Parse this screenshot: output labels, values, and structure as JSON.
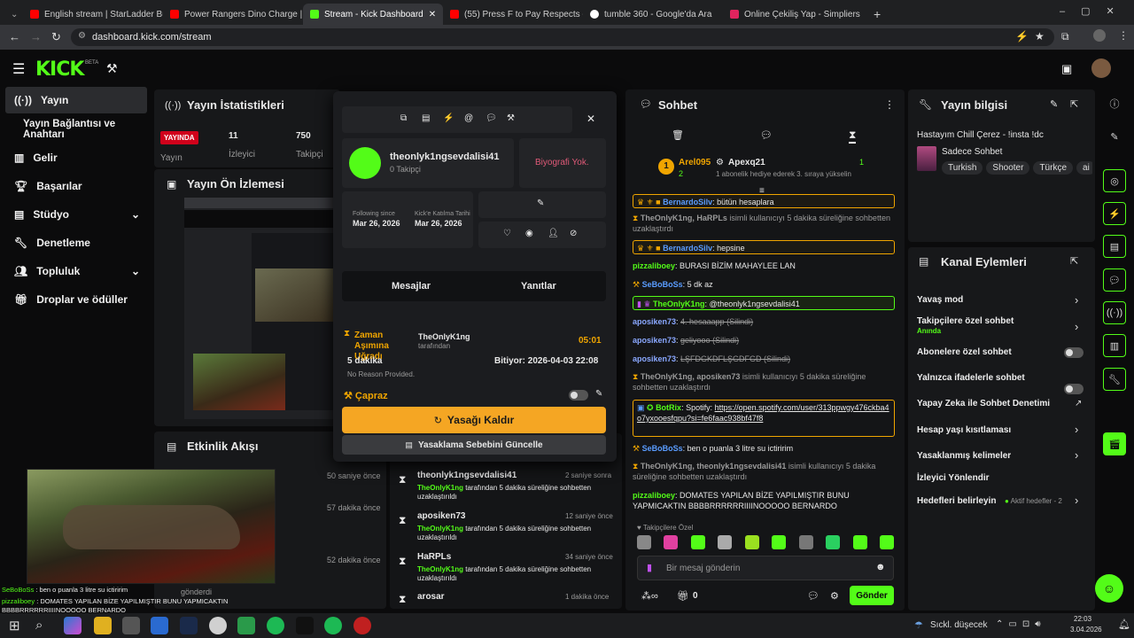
{
  "browser": {
    "tabs": [
      {
        "title": "English stream | StarLadder Bud",
        "color": "#ff0000"
      },
      {
        "title": "Power Rangers Dino Charge | S",
        "color": "#ff0000"
      },
      {
        "title": "Stream - Kick Dashboard",
        "color": "#53fc18"
      },
      {
        "title": "(55) Press F to Pay Respects - Y",
        "color": "#ff0000"
      },
      {
        "title": "tumble 360 - Google'da Ara",
        "color": "#ffffff"
      },
      {
        "title": "Online Çekiliş Yap - Simpliers",
        "color": "#e0245e"
      }
    ],
    "url": "dashboard.kick.com/stream"
  },
  "header": {
    "logo": "KICK",
    "beta": "BETA"
  },
  "sidebar": {
    "items": [
      {
        "label": "Yayın",
        "icon": "broadcast-icon"
      },
      {
        "label": "Yayın Bağlantısı ve Anahtarı"
      },
      {
        "label": "Gelir",
        "icon": "chart-icon"
      },
      {
        "label": "Başarılar",
        "icon": "trophy-icon"
      },
      {
        "label": "Stüdyo",
        "icon": "studio-icon"
      },
      {
        "label": "Denetleme",
        "icon": "wrench-icon"
      },
      {
        "label": "Topluluk",
        "icon": "community-icon"
      },
      {
        "label": "Droplar ve ödüller",
        "icon": "gift-icon"
      }
    ]
  },
  "stats": {
    "title": "Yayın İstatistikleri",
    "live_badge": "YAYINDA",
    "live_label": "Yayın",
    "viewers_value": "11",
    "viewers_label": "İzleyici",
    "followers_value": "750",
    "followers_label": "Takipçi"
  },
  "preview": {
    "title": "Yayın Ön İzlemesi"
  },
  "activity": {
    "title": "Etkinlik Akışı",
    "times": [
      "50 saniye önce",
      "57 dakika önce",
      "52 dakika önce"
    ],
    "bottom_label": "gönderdi"
  },
  "usercard": {
    "username": "theonlyk1ngsevdalisi41",
    "followers": "0 Takipçi",
    "bio": "Biyografi Yok.",
    "following_since_label": "Following since",
    "following_since": "Mar 26, 2026",
    "kick_join_label": "Kick'e Katılma Tarihi",
    "kick_join": "Mar 26, 2026",
    "tab_messages": "Mesajlar",
    "tab_replies": "Yanıtlar",
    "timeout_title": "Zaman Aşımına Uğradı",
    "timeout_by": "TheOnlyK1ng",
    "timeout_by_suffix": "tarafından",
    "timeout_timer": "05:01",
    "timeout_duration": "5 dakika",
    "timeout_ends": "Bitiyor: 2026-04-03 22:08",
    "no_reason": "No Reason Provided.",
    "cross_label": "Çapraz",
    "unban_button": "Yasağı Kaldır",
    "update_reason_button": "Yasaklama Sebebini Güncelle"
  },
  "modfeed": {
    "rows": [
      {
        "user": "theonlyk1ngsevdalisi41",
        "time": "2 saniye sonra",
        "by": "TheOnlyK1ng",
        "text": "tarafından 5 dakika süreliğine sohbetten uzaklaştırıldı"
      },
      {
        "user": "aposiken73",
        "time": "12 saniye önce",
        "by": "TheOnlyK1ng",
        "text": "tarafından 5 dakika süreliğine sohbetten uzaklaştırıldı"
      },
      {
        "user": "HaRPLs",
        "time": "34 saniye önce",
        "by": "TheOnlyK1ng",
        "text": "tarafından 5 dakika süreliğine sohbetten uzaklaştırıldı"
      },
      {
        "user": "arosar",
        "time": "1 dakika önce",
        "by": "",
        "text": ""
      }
    ]
  },
  "chat": {
    "title": "Sohbet",
    "gift_user1": "Arel095",
    "gift_count1": "2",
    "gift_user2": "Apexq21",
    "gift_count2": "1",
    "gift_text": "1 abonelik hediye ederek 3. sıraya yükselin",
    "input_placeholder": "Bir mesaj gönderin",
    "send_button": "Gönder",
    "points": "0",
    "follower_emotes_label": "Takipçilere Özel",
    "messages": [
      {
        "user": "BernardoSilv",
        "text": "bütün hesaplara"
      },
      {
        "user": "TheOnlyK1ng, HaRPLs",
        "text": "isimli kullanıcıyı 5 dakika süreliğine sohbetten uzaklaştırdı"
      },
      {
        "user": "BernardoSilv",
        "text": "hepsine"
      },
      {
        "user": "pizzaliboey",
        "text": "BURASI BİZİM MAHAYLEE LAN"
      },
      {
        "user": "SeBoBoSs",
        "text": "5 dk az"
      },
      {
        "user": "TheOnlyK1ng",
        "text": "@theonlyk1ngsevdalisi41"
      },
      {
        "user": "aposiken73",
        "text": "4. hesaaapp (Silindi)"
      },
      {
        "user": "aposiken73",
        "text": "geliyooo (Silindi)"
      },
      {
        "user": "aposiken73",
        "text": "LŞFDGKDFLŞGDFGD (Silindi)"
      },
      {
        "user": "TheOnlyK1ng, aposiken73",
        "text": "isimli kullanıcıyı 5 dakika süreliğine sohbetten uzaklaştırdı"
      },
      {
        "user": "BotRix",
        "text": "Spotify:",
        "link": "https://open.spotify.com/user/313ppwgy476ckba4o7yxooesfqpu?si=fe6faac938bf47f8"
      },
      {
        "user": "SeBoBoSs",
        "text": "ben o puanla 3 litre su ictiririm"
      },
      {
        "user": "TheOnlyK1ng, theonlyk1ngsevdalisi41",
        "text": "isimli kullanıcıyı 5 dakika süreliğine sohbetten uzaklaştırdı"
      },
      {
        "user": "pizzaliboey",
        "text": "DOMATES YAPILAN BİZE YAPILMIŞTIR BUNU YAPMICAKTIN BBBBRRRRRRIIIINOOOOO BERNARDO"
      }
    ]
  },
  "streaminfo": {
    "title": "Yayın bilgisi",
    "stream_title": "Hastayım Chill Çerez - !insta !dc",
    "category": "Sadece Sohbet",
    "tags": [
      "Turkish",
      "Shooter",
      "Türkçe",
      "ai"
    ]
  },
  "channel_actions": {
    "title": "Kanal Eylemleri",
    "items": [
      {
        "label": "Yavaş mod",
        "control": "chevron"
      },
      {
        "label": "Takipçilere özel sohbet",
        "sub": "Anında",
        "control": "chevron"
      },
      {
        "label": "Abonelere özel sohbet",
        "control": "toggle"
      },
      {
        "label": "Yalnızca ifadelerle sohbet",
        "control": "toggle"
      },
      {
        "label": "Yapay Zeka ile Sohbet Denetimi",
        "control": "external"
      },
      {
        "label": "Hesap yaşı kısıtlaması",
        "control": "chevron"
      },
      {
        "label": "Yasaklanmış kelimeler",
        "control": "chevron"
      },
      {
        "label": "İzleyici Yönlendir",
        "control": "none"
      },
      {
        "label": "Hedefleri belirleyin",
        "sub": "Aktif hedefler - 2",
        "control": "chevron"
      }
    ]
  },
  "overlay": {
    "line1_user": "SeBoBoSs",
    "line1_text": "ben o puanla 3 litre su ictiririm",
    "line2_user": "pizzaliboey",
    "line2_text": "DOMATES YAPILAN BİZE YAPILMIŞTIR BUNU YAPMICAKTIN BBBBRRRRRRIIIINOOOOO BERNARDO"
  },
  "taskbar": {
    "weather": "Sıckl. düşecek",
    "time": "22:03",
    "date": "3.04.2026"
  },
  "colors": {
    "accent": "#53fc18",
    "warn": "#f0a500",
    "bg": "#0b0b0c",
    "card": "#17181a"
  }
}
